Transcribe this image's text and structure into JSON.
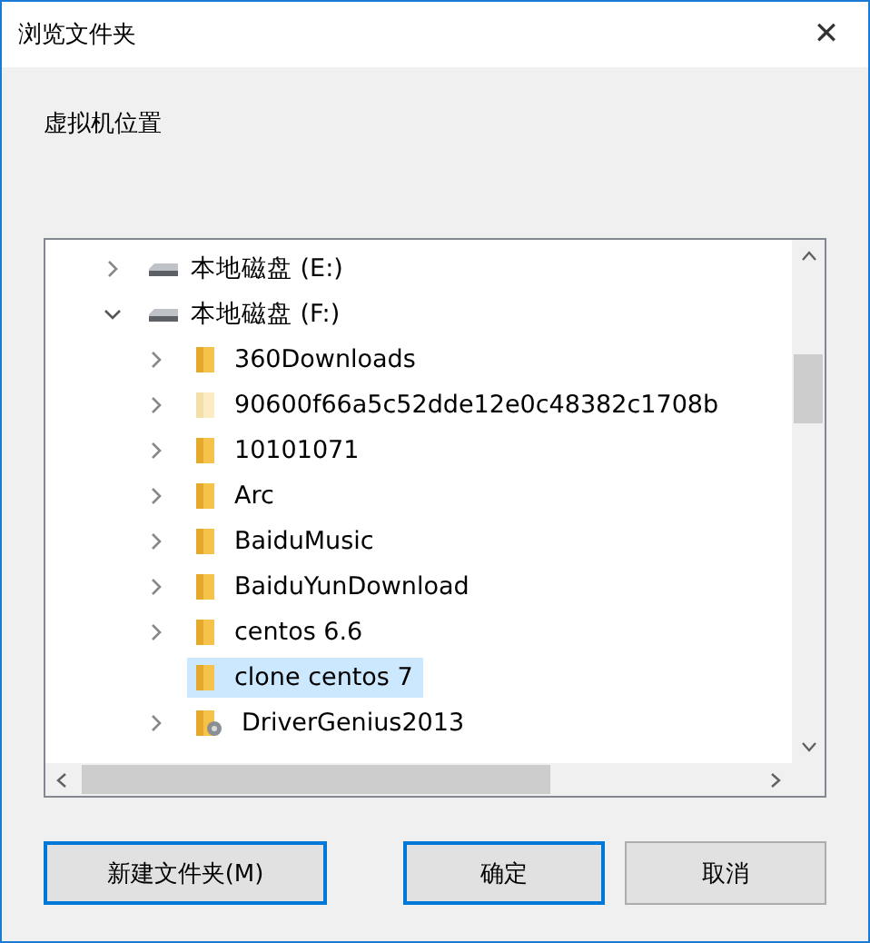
{
  "window": {
    "title": "浏览文件夹",
    "close": "✕"
  },
  "prompt": "虚拟机位置",
  "tree": [
    {
      "label": "本地磁盘 (E:)",
      "kind": "drive",
      "expanded": false,
      "selected": false,
      "has_children": true
    },
    {
      "label": "本地磁盘 (F:)",
      "kind": "drive",
      "expanded": true,
      "selected": false,
      "has_children": true,
      "children": [
        {
          "label": "360Downloads",
          "kind": "folder",
          "selected": false,
          "has_children": true
        },
        {
          "label": "90600f66a5c52dde12e0c48382c1708b",
          "kind": "hidden-folder",
          "selected": false,
          "has_children": true
        },
        {
          "label": "10101071",
          "kind": "folder",
          "selected": false,
          "has_children": true
        },
        {
          "label": "Arc",
          "kind": "folder",
          "selected": false,
          "has_children": true
        },
        {
          "label": "BaiduMusic",
          "kind": "folder",
          "selected": false,
          "has_children": true
        },
        {
          "label": "BaiduYunDownload",
          "kind": "folder",
          "selected": false,
          "has_children": true
        },
        {
          "label": "centos 6.6",
          "kind": "folder",
          "selected": false,
          "has_children": true
        },
        {
          "label": "clone centos 7",
          "kind": "folder",
          "selected": true,
          "has_children": false
        },
        {
          "label": "DriverGenius2013",
          "kind": "program-folder",
          "selected": false,
          "has_children": true
        }
      ]
    }
  ],
  "buttons": [
    {
      "label": "新建文件夹(M)",
      "default": false,
      "focused": true
    },
    {
      "label": "确定",
      "default": true,
      "focused": false
    },
    {
      "label": "取消",
      "default": false,
      "focused": false
    }
  ]
}
